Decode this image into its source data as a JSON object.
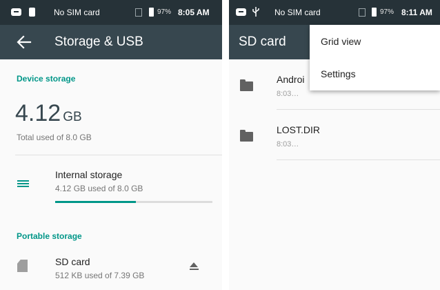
{
  "left_screen": {
    "status_bar": {
      "carrier": "No SIM card",
      "battery": "97%",
      "time": "8:05 AM"
    },
    "app_bar": {
      "title": "Storage & USB",
      "back_icon": "arrow-left-icon"
    },
    "device_storage": {
      "header": "Device storage",
      "used_value": "4.12",
      "used_unit": "GB",
      "total_text": "Total used of 8.0 GB"
    },
    "internal_storage": {
      "title": "Internal storage",
      "subtitle": "4.12 GB used of 8.0 GB",
      "icon": "storage-list-icon",
      "usage_fraction": 0.515
    },
    "portable_storage": {
      "header": "Portable storage",
      "sd_title": "SD card",
      "sd_subtitle": "512 KB used of 7.39 GB",
      "icon": "sd-card-icon",
      "eject_icon": "eject-icon"
    }
  },
  "right_screen": {
    "status_bar": {
      "carrier": "No SIM card",
      "battery": "97%",
      "time": "8:11 AM"
    },
    "app_bar": {
      "title": "SD card"
    },
    "files": [
      {
        "name": "Androi",
        "date": "8:03…"
      },
      {
        "name": "LOST.DIR",
        "date": "8:03…"
      }
    ],
    "menu": {
      "items": [
        "Grid view",
        "Settings"
      ]
    }
  },
  "colors": {
    "status_bar": "#263238",
    "app_bar": "#37474f",
    "accent": "#009688"
  }
}
